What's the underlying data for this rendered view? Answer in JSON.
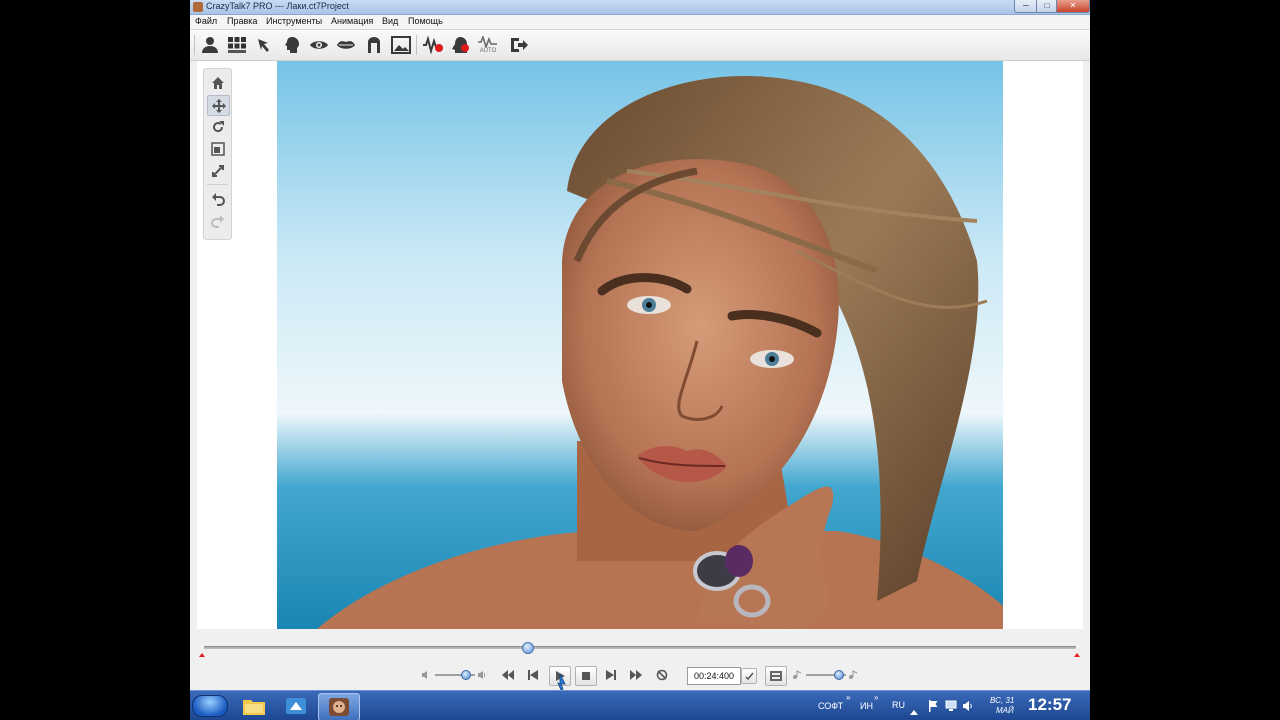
{
  "window": {
    "title": "CrazyTalk7 PRO --- Лаки.ct7Project",
    "min_label": "─",
    "max_label": "□",
    "close_label": "✕"
  },
  "menu": {
    "items": [
      "Файл",
      "Правка",
      "Инструменты",
      "Анимация",
      "Вид",
      "Помощь"
    ]
  },
  "toolbar": {
    "icons": [
      "person-icon",
      "grid-icon",
      "hand-pointer-icon",
      "head-profile-icon",
      "eye-icon",
      "mouth-icon",
      "face-outline-icon",
      "background-image-icon",
      "voice-record-icon",
      "face-record-icon",
      "auto-motion-icon",
      "export-icon"
    ],
    "auto_label": "AUTO"
  },
  "sidetools": {
    "icons": [
      "home-icon",
      "move-icon",
      "rotate-icon",
      "scale-icon",
      "fit-icon",
      "undo-icon",
      "redo-icon"
    ]
  },
  "timeline": {
    "progress": 0.37
  },
  "playback": {
    "time": "00:24:400",
    "volume": 0.75,
    "speed": 0.8
  },
  "taskbar": {
    "tray": {
      "label_soft": "СОФТ",
      "label_in": "ИН",
      "lang": "RU",
      "date_line1": "ВС, 31",
      "date_line2": "МАЙ",
      "clock": "12:57",
      "chevron": "»"
    }
  },
  "colors": {
    "accent": "#2f67c5",
    "record_red": "#e01919",
    "taskbar": "#244f9c"
  }
}
